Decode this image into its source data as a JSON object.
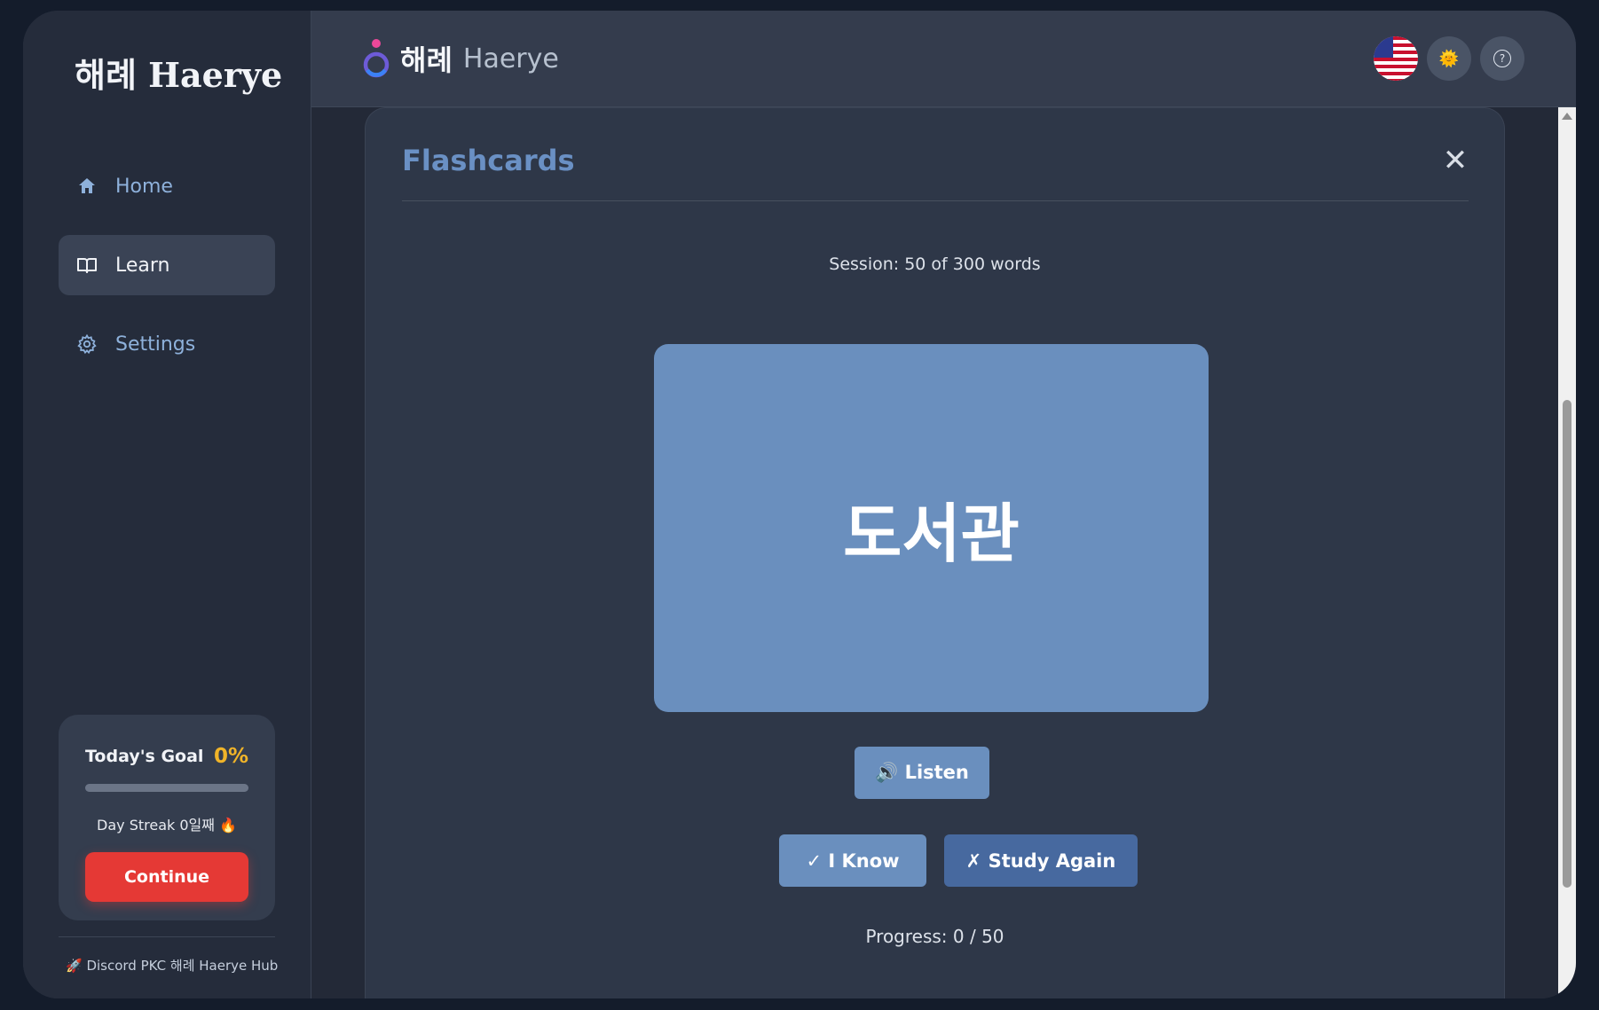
{
  "sidebar": {
    "brand": "해례 Haerye",
    "nav": [
      {
        "label": "Home",
        "icon": "home-icon",
        "active": false
      },
      {
        "label": "Learn",
        "icon": "book-icon",
        "active": true
      },
      {
        "label": "Settings",
        "icon": "gear-icon",
        "active": false
      }
    ],
    "goal": {
      "title": "Today's Goal",
      "percent_label": "0%",
      "progress": 0,
      "streak": "Day Streak 0일째 🔥",
      "continue_label": "Continue"
    },
    "discord": "🚀 Discord PKC 해례 Haerye Hub"
  },
  "header": {
    "logo_ko": "해례",
    "logo_en": "Haerye",
    "buttons": [
      {
        "name": "language-flag-us",
        "icon": "us-flag-icon"
      },
      {
        "name": "theme-toggle",
        "icon": "sun-icon",
        "glyph": "🌞"
      },
      {
        "name": "help",
        "icon": "help-icon",
        "glyph": "?"
      }
    ]
  },
  "modal": {
    "title": "Flashcards",
    "close_glyph": "✕",
    "session": "Session: 50 of 300 words",
    "card_word": "도서관",
    "listen_label": "🔊 Listen",
    "know_label": "✓ I Know",
    "again_label": "✗ Study Again",
    "progress": "Progress: 0 / 50"
  },
  "colors": {
    "accent": "#6a8fbe",
    "accent_dark": "#47699f",
    "title_blue": "#6a90c4",
    "continue_red": "#e53935",
    "goal_yellow": "#f0b429"
  }
}
